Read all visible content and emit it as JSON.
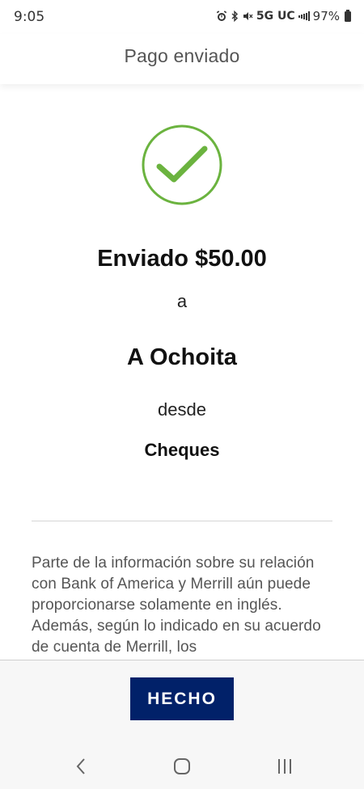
{
  "status_bar": {
    "time": "9:05",
    "network": "5G UC",
    "battery": "97%"
  },
  "header": {
    "title": "Pago enviado"
  },
  "confirmation": {
    "icon": "checkmark-circle-icon",
    "sent_amount": "Enviado $50.00",
    "to_label": "a",
    "recipient": "A Ochoita",
    "from_label": "desde",
    "account": "Cheques"
  },
  "disclaimer": {
    "text": "Parte de la información sobre su relación con Bank of America y Merrill aún puede proporcionarse solamente en inglés. Además, según lo indicado en su acuerdo de cuenta de Merrill, los"
  },
  "footer": {
    "done_label": "HECHO"
  },
  "colors": {
    "accent_green": "#6bb33f",
    "button_navy": "#012169"
  },
  "nav_bar": {
    "back": "back-icon",
    "home": "home-icon",
    "recents": "recents-icon"
  }
}
